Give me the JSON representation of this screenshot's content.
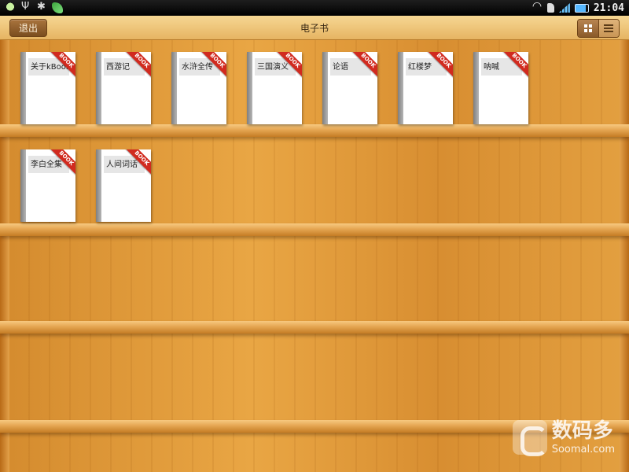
{
  "status_bar": {
    "left_icons": [
      "bulb-icon",
      "usb-icon",
      "bug-icon",
      "leaf-icon"
    ],
    "right_icons": [
      "wifi-icon",
      "sd-card-icon",
      "signal-icon",
      "battery-icon"
    ],
    "time": "21:04"
  },
  "toolbar": {
    "exit_label": "退出",
    "title": "电子书",
    "view_modes": [
      "grid-view",
      "list-view"
    ],
    "active_view": "grid-view"
  },
  "books": [
    {
      "title": "关于kBook",
      "badge": "BOOK"
    },
    {
      "title": "西游记",
      "badge": "BOOK"
    },
    {
      "title": "水浒全传",
      "badge": "BOOK"
    },
    {
      "title": "三国演义",
      "badge": "BOOK"
    },
    {
      "title": "论语",
      "badge": "BOOK"
    },
    {
      "title": "红楼梦",
      "badge": "BOOK"
    },
    {
      "title": "呐喊",
      "badge": "BOOK"
    },
    {
      "title": "李白全集",
      "badge": "BOOK"
    },
    {
      "title": "人间词话",
      "badge": "BOOK"
    }
  ],
  "watermark": {
    "cn": "数码多",
    "en": "Soomal.com"
  },
  "colors": {
    "wood": "#e3a040",
    "ribbon": "#d12a1f",
    "toolbar": "#e6b462"
  }
}
